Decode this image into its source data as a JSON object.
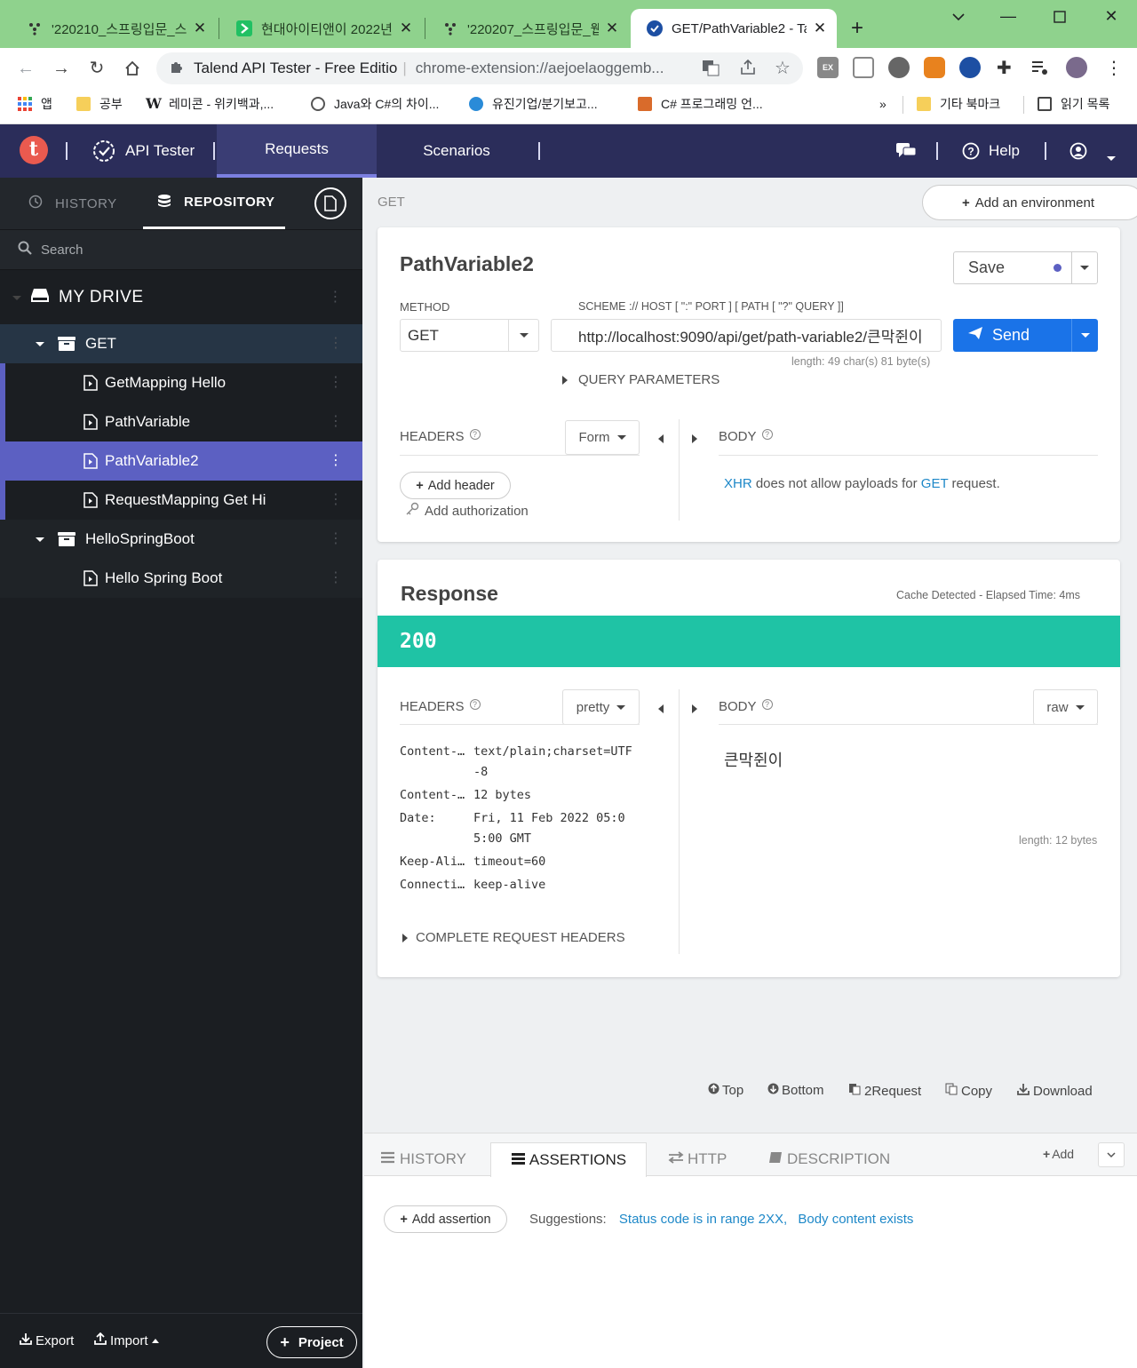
{
  "browser": {
    "tabs": [
      {
        "title": "'220210_스프링입문_스"
      },
      {
        "title": "현대아이티앤이 2022년"
      },
      {
        "title": "'220207_스프링입문_웹"
      },
      {
        "title": "GET/PathVariable2 - Ta",
        "active": true
      }
    ],
    "omnibox": {
      "extension_name": "Talend API Tester - Free Editio",
      "url": "chrome-extension://aejoelaoggemb..."
    },
    "bookmarks": [
      {
        "label": "앱"
      },
      {
        "label": "공부"
      },
      {
        "label": "레미콘 - 위키백과,..."
      },
      {
        "label": "Java와 C#의 차이..."
      },
      {
        "label": "유진기업/분기보고..."
      },
      {
        "label": "C# 프로그래밍 언..."
      }
    ],
    "bookmarks_overflow": "»",
    "bookmarks_right": [
      {
        "label": "기타 북마크"
      },
      {
        "label": "읽기 목록"
      }
    ]
  },
  "app": {
    "brand_label": "API Tester",
    "logo_letter": "t",
    "nav": {
      "requests": "Requests",
      "scenarios": "Scenarios",
      "help": "Help"
    },
    "colors": {
      "header_bg": "#2b2d5a",
      "accent": "#5c60c2",
      "status_ok": "#1fc3a5",
      "send": "#1a73e8"
    }
  },
  "sidebar": {
    "tabs": {
      "history": "HISTORY",
      "repository": "REPOSITORY"
    },
    "search_placeholder": "Search",
    "drive_label": "MY DRIVE",
    "tree": [
      {
        "label": "GET",
        "kind": "folder"
      },
      {
        "label": "GetMapping Hello",
        "kind": "request"
      },
      {
        "label": "PathVariable",
        "kind": "request"
      },
      {
        "label": "PathVariable2",
        "kind": "request",
        "selected": true
      },
      {
        "label": "RequestMapping Get Hi",
        "kind": "request"
      },
      {
        "label": "HelloSpringBoot",
        "kind": "folder"
      },
      {
        "label": "Hello Spring Boot",
        "kind": "request"
      }
    ],
    "footer": {
      "export": "Export",
      "import": "Import",
      "project": "Project"
    }
  },
  "request": {
    "breadcrumb": "GET",
    "add_environment": "Add an environment",
    "name": "PathVariable2",
    "save_label": "Save",
    "method_label": "METHOD",
    "method": "GET",
    "url_label": "SCHEME :// HOST [ \":\" PORT ] [ PATH [ \"?\" QUERY ]]",
    "url": "http://localhost:9090/api/get/path-variable2/큰막쥔이",
    "url_length": "length: 49 char(s) 81 byte(s)",
    "send_label": "Send",
    "query_parameters": "QUERY PARAMETERS",
    "headers_label": "HEADERS",
    "headers_mode": "Form",
    "body_label": "BODY",
    "add_header": "Add header",
    "add_authorization": "Add authorization",
    "body_note": {
      "xhr": "XHR",
      "middle": "does not allow payloads for",
      "get": "GET",
      "end": "request."
    }
  },
  "response": {
    "title": "Response",
    "meta": "Cache Detected - Elapsed Time: 4ms",
    "status": "200",
    "headers_label": "HEADERS",
    "headers_mode": "pretty",
    "body_label": "BODY",
    "body_mode": "raw",
    "headers": [
      {
        "name": "Content-…",
        "value": "text/plain;charset=UTF",
        "value2": "-8"
      },
      {
        "name": "Content-…",
        "value": "12 bytes"
      },
      {
        "name": "Date:",
        "value": "Fri, 11 Feb 2022 05:0",
        "value2": "5:00 GMT"
      },
      {
        "name": "Keep-Ali…",
        "value": "timeout=60"
      },
      {
        "name": "Connecti…",
        "value": "keep-alive"
      }
    ],
    "complete_headers": "COMPLETE REQUEST HEADERS",
    "body": "큰막쥔이",
    "body_length": "length: 12 bytes"
  },
  "actions": {
    "top": "Top",
    "bottom": "Bottom",
    "to_request": "2Request",
    "copy": "Copy",
    "download": "Download"
  },
  "bottom_panel": {
    "tabs": {
      "history": "HISTORY",
      "assertions": "ASSERTIONS",
      "http": "HTTP",
      "description": "DESCRIPTION"
    },
    "add": "Add",
    "add_assertion": "Add assertion",
    "suggestions_label": "Suggestions:",
    "suggestions": [
      "Status code is in range 2XX,",
      "Body content exists"
    ]
  }
}
